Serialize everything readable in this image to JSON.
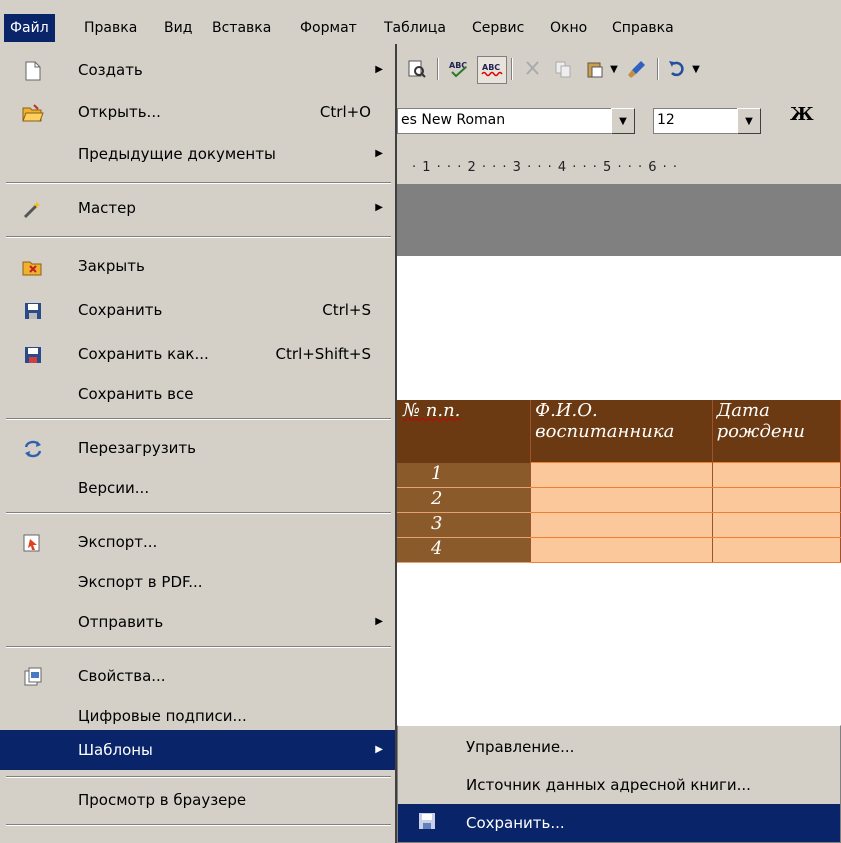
{
  "menubar": {
    "items": [
      "Файл",
      "Правка",
      "Вид",
      "Вставка",
      "Формат",
      "Таблица",
      "Сервис",
      "Окно",
      "Справка"
    ]
  },
  "toolbar": {
    "font_name": "es New Roman",
    "font_size": "12",
    "bold_label": "Ж"
  },
  "ruler": {
    "marks": "· 1 · · · 2 · · · 3 · · · 4 · · · 5 · · · 6 · ·"
  },
  "table": {
    "headers": [
      "№ п.п.",
      "Ф.И.О. воспитанника",
      "Дата рождени"
    ],
    "rows": [
      "1",
      "2",
      "3",
      "4"
    ]
  },
  "file_menu": {
    "items": [
      {
        "label": "Создать",
        "shortcut": "",
        "submenu": true
      },
      {
        "label": "Открыть...",
        "shortcut": "Ctrl+O",
        "submenu": false
      },
      {
        "label": "Предыдущие документы",
        "shortcut": "",
        "submenu": true
      },
      {
        "label": "Мастер",
        "shortcut": "",
        "submenu": true
      },
      {
        "label": "Закрыть",
        "shortcut": "",
        "submenu": false
      },
      {
        "label": "Сохранить",
        "shortcut": "Ctrl+S",
        "submenu": false
      },
      {
        "label": "Сохранить как...",
        "shortcut": "Ctrl+Shift+S",
        "submenu": false
      },
      {
        "label": "Сохранить все",
        "shortcut": "",
        "submenu": false
      },
      {
        "label": "Перезагрузить",
        "shortcut": "",
        "submenu": false
      },
      {
        "label": "Версии...",
        "shortcut": "",
        "submenu": false
      },
      {
        "label": "Экспорт...",
        "shortcut": "",
        "submenu": false
      },
      {
        "label": "Экспорт в PDF...",
        "shortcut": "",
        "submenu": false
      },
      {
        "label": "Отправить",
        "shortcut": "",
        "submenu": true
      },
      {
        "label": "Свойства...",
        "shortcut": "",
        "submenu": false
      },
      {
        "label": "Цифровые подписи...",
        "shortcut": "",
        "submenu": false
      },
      {
        "label": "Шаблоны",
        "shortcut": "",
        "submenu": true
      },
      {
        "label": "Просмотр в браузере",
        "shortcut": "",
        "submenu": false
      }
    ]
  },
  "templates_submenu": {
    "items": [
      "Управление...",
      "Источник данных адресной книги...",
      "Сохранить..."
    ]
  },
  "colors": {
    "menu_bg": "#d4d0c8",
    "highlight": "#0a246a",
    "table_header": "#6b3a12",
    "table_num": "#8b5a2b",
    "table_cell": "#fbc89b"
  }
}
